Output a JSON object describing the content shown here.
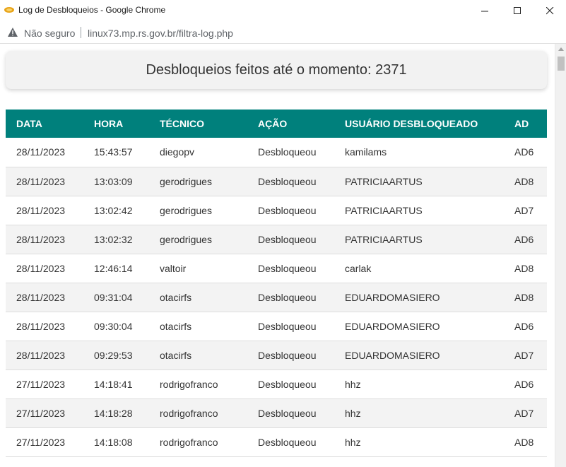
{
  "window": {
    "title": "Log de Desbloqueios - Google Chrome",
    "controls": {
      "minimize": "—",
      "maximize": "☐",
      "close": "✕"
    }
  },
  "addressbar": {
    "security_label": "Não seguro",
    "url": "linux73.mp.rs.gov.br/filtra-log.php"
  },
  "counter": {
    "text": "Desbloqueios feitos até o momento: 2371"
  },
  "table": {
    "headers": [
      "DATA",
      "HORA",
      "TÉCNICO",
      "AÇÃO",
      "USUÁRIO DESBLOQUEADO",
      "AD"
    ],
    "rows": [
      [
        "28/11/2023",
        "15:43:57",
        "diegopv",
        "Desbloqueou",
        "kamilams",
        "AD6"
      ],
      [
        "28/11/2023",
        "13:03:09",
        "gerodrigues",
        "Desbloqueou",
        "PATRICIAARTUS",
        "AD8"
      ],
      [
        "28/11/2023",
        "13:02:42",
        "gerodrigues",
        "Desbloqueou",
        "PATRICIAARTUS",
        "AD7"
      ],
      [
        "28/11/2023",
        "13:02:32",
        "gerodrigues",
        "Desbloqueou",
        "PATRICIAARTUS",
        "AD6"
      ],
      [
        "28/11/2023",
        "12:46:14",
        "valtoir",
        "Desbloqueou",
        "carlak",
        "AD8"
      ],
      [
        "28/11/2023",
        "09:31:04",
        "otacirfs",
        "Desbloqueou",
        "EDUARDOMASIERO",
        "AD8"
      ],
      [
        "28/11/2023",
        "09:30:04",
        "otacirfs",
        "Desbloqueou",
        "EDUARDOMASIERO",
        "AD6"
      ],
      [
        "28/11/2023",
        "09:29:53",
        "otacirfs",
        "Desbloqueou",
        "EDUARDOMASIERO",
        "AD7"
      ],
      [
        "27/11/2023",
        "14:18:41",
        "rodrigofranco",
        "Desbloqueou",
        "hhz",
        "AD6"
      ],
      [
        "27/11/2023",
        "14:18:28",
        "rodrigofranco",
        "Desbloqueou",
        "hhz",
        "AD7"
      ],
      [
        "27/11/2023",
        "14:18:08",
        "rodrigofranco",
        "Desbloqueou",
        "hhz",
        "AD8"
      ]
    ]
  },
  "colors": {
    "header_bg": "#00807c",
    "header_text": "#ffffff",
    "row_alt_bg": "#f3f3f3",
    "counter_bg": "#f2f2f2"
  }
}
